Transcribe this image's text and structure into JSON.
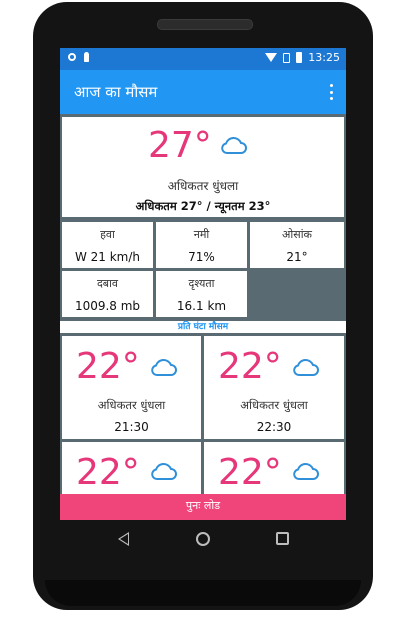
{
  "status_bar": {
    "time": "13:25",
    "icons": [
      "sync-icon",
      "pin-icon",
      "wifi-icon",
      "sim-icon",
      "battery-icon"
    ]
  },
  "app_bar": {
    "title": "आज का मौसम",
    "menu_icon": "more-vert-icon"
  },
  "current": {
    "temperature": "27°",
    "condition": "अधिकतर  धुंधला",
    "max_min": "अधिकतम 27° / न्यूनतम 23°",
    "icon": "cloud-icon"
  },
  "stats": [
    {
      "label": "हवा",
      "value": "W 21 km/h"
    },
    {
      "label": "नमी",
      "value": "71%"
    },
    {
      "label": "ओसांक",
      "value": "21°"
    },
    {
      "label": "दबाव",
      "value": "1009.8 mb"
    },
    {
      "label": "दृश्यता",
      "value": "16.1 km"
    }
  ],
  "hourly_title": "प्रति घंटा मौसम",
  "hourly": [
    {
      "temperature": "22°",
      "condition": "अधिकतर  धुंधला",
      "time": "21:30",
      "icon": "cloud-icon"
    },
    {
      "temperature": "22°",
      "condition": "अधिकतर  धुंधला",
      "time": "22:30",
      "icon": "cloud-icon"
    },
    {
      "temperature": "22°",
      "condition": "",
      "time": "",
      "icon": "cloud-icon"
    },
    {
      "temperature": "22°",
      "condition": "",
      "time": "",
      "icon": "cloud-icon"
    }
  ],
  "reload_label": "पुनः लोड",
  "colors": {
    "primary": "#2196f3",
    "status_bar": "#1c78d3",
    "temperature": "#e6377a",
    "reload": "#f0457b",
    "icon": "#2f8fd8"
  },
  "nav_bar": {
    "icons": [
      "back-icon",
      "home-icon",
      "recent-apps-icon"
    ]
  }
}
